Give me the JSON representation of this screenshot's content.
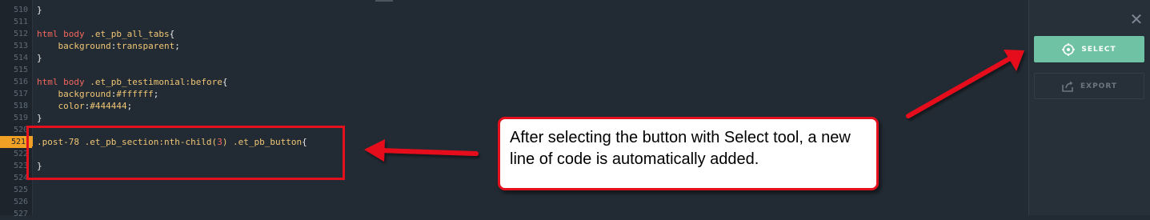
{
  "editor": {
    "lines": [
      {
        "num": "510",
        "tokens": [
          {
            "t": "}",
            "c": "punct"
          }
        ]
      },
      {
        "num": "511",
        "tokens": []
      },
      {
        "num": "512",
        "tokens": [
          {
            "t": "html body ",
            "c": "sel"
          },
          {
            "t": ".et_pb_all_tabs",
            "c": "cls"
          },
          {
            "t": "{",
            "c": "punct"
          }
        ]
      },
      {
        "num": "513",
        "tokens": [
          {
            "t": "    background",
            "c": "prop"
          },
          {
            "t": ":",
            "c": "punct"
          },
          {
            "t": "transparent",
            "c": "val"
          },
          {
            "t": ";",
            "c": "punct"
          }
        ]
      },
      {
        "num": "514",
        "tokens": [
          {
            "t": "}",
            "c": "punct"
          }
        ]
      },
      {
        "num": "515",
        "tokens": []
      },
      {
        "num": "516",
        "tokens": [
          {
            "t": "html body ",
            "c": "sel"
          },
          {
            "t": ".et_pb_testimonial",
            "c": "cls"
          },
          {
            "t": ":before",
            "c": "cls"
          },
          {
            "t": "{",
            "c": "punct"
          }
        ]
      },
      {
        "num": "517",
        "tokens": [
          {
            "t": "    background",
            "c": "prop"
          },
          {
            "t": ":",
            "c": "punct"
          },
          {
            "t": "#ffffff",
            "c": "val"
          },
          {
            "t": ";",
            "c": "punct"
          }
        ]
      },
      {
        "num": "518",
        "tokens": [
          {
            "t": "    color",
            "c": "prop"
          },
          {
            "t": ":",
            "c": "punct"
          },
          {
            "t": "#444444",
            "c": "val"
          },
          {
            "t": ";",
            "c": "punct"
          }
        ]
      },
      {
        "num": "519",
        "tokens": [
          {
            "t": "}",
            "c": "punct"
          }
        ]
      },
      {
        "num": "520",
        "tokens": []
      },
      {
        "num": "521",
        "active": true,
        "tokens": [
          {
            "t": ".post-78 .et_pb_section",
            "c": "cls"
          },
          {
            "t": ":nth-child(",
            "c": "cls"
          },
          {
            "t": "3",
            "c": "num"
          },
          {
            "t": ") .et_pb_button",
            "c": "cls"
          },
          {
            "t": "{",
            "c": "punct"
          }
        ]
      },
      {
        "num": "522",
        "tokens": []
      },
      {
        "num": "523",
        "tokens": [
          {
            "t": "}",
            "c": "punct"
          }
        ]
      },
      {
        "num": "524",
        "tokens": []
      },
      {
        "num": "525",
        "tokens": []
      },
      {
        "num": "526",
        "tokens": []
      },
      {
        "num": "527",
        "tokens": []
      }
    ]
  },
  "panel": {
    "close_icon": "close-icon",
    "select_label": "SELECT",
    "select_icon": "crosshair-icon",
    "export_label": "EXPORT",
    "export_icon": "export-icon",
    "accent_color": "#6fc2a4"
  },
  "annotation": {
    "callout_text": "After selecting the button with Select tool, a new line of code is automatically added.",
    "color": "#e5101d"
  }
}
